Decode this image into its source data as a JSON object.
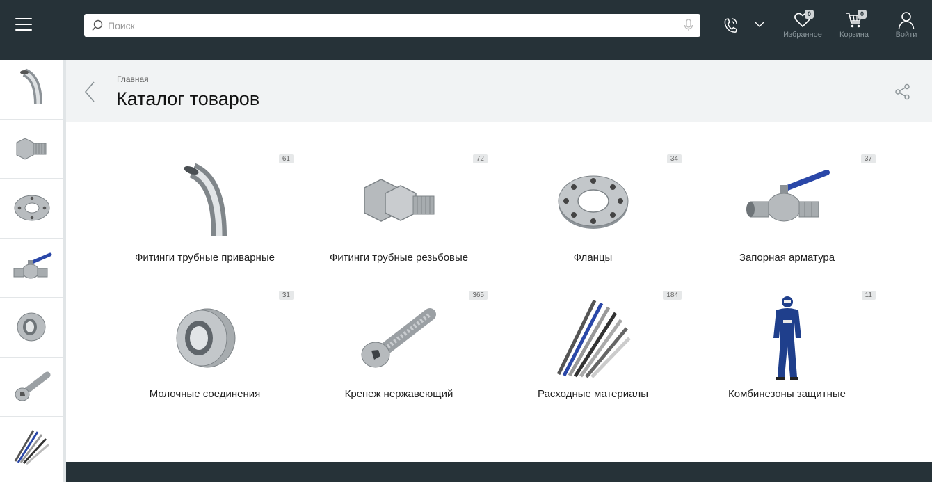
{
  "header": {
    "search": {
      "placeholder": "Поиск",
      "value": ""
    },
    "favorites": {
      "label": "Избранное",
      "count": "0"
    },
    "cart": {
      "label": "Корзина",
      "count": "0"
    },
    "login": {
      "label": "Войти"
    }
  },
  "page": {
    "breadcrumb": "Главная",
    "title": "Каталог товаров"
  },
  "categories": [
    {
      "name": "Фитинги трубные приварные",
      "count": "61",
      "icon": "pipe-elbow-icon"
    },
    {
      "name": "Фитинги трубные резьбовые",
      "count": "72",
      "icon": "threaded-union-icon"
    },
    {
      "name": "Фланцы",
      "count": "34",
      "icon": "flange-icon"
    },
    {
      "name": "Запорная арматура",
      "count": "37",
      "icon": "ball-valve-icon"
    },
    {
      "name": "Молочные соединения",
      "count": "31",
      "icon": "dairy-union-icon"
    },
    {
      "name": "Крепеж нержавеющий",
      "count": "365",
      "icon": "bolt-icon"
    },
    {
      "name": "Расходные материалы",
      "count": "184",
      "icon": "welding-rods-icon"
    },
    {
      "name": "Комбинезоны защитные",
      "count": "11",
      "icon": "protective-suit-icon"
    }
  ],
  "sidebar_icons": [
    "pipe-elbow-icon",
    "threaded-union-icon",
    "flange-icon",
    "ball-valve-icon",
    "dairy-union-icon",
    "bolt-icon",
    "welding-rods-icon"
  ],
  "colors": {
    "topbar": "#263238",
    "header_bg": "#f1f3f4",
    "valve_handle": "#2a47a8"
  }
}
